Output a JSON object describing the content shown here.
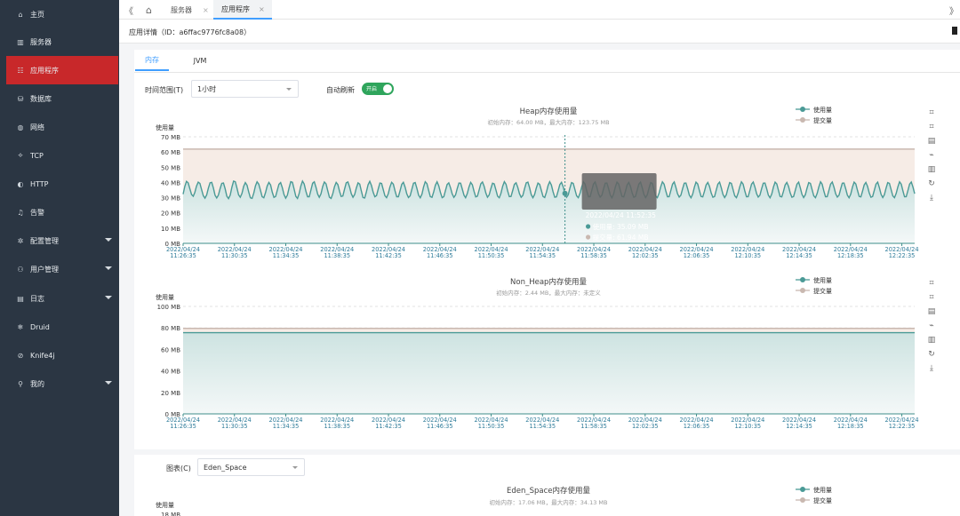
{
  "sidebar": {
    "items": [
      {
        "label": "主页",
        "icon": "home-icon",
        "glyph": "⌂"
      },
      {
        "label": "服务器",
        "icon": "server-icon",
        "glyph": "▥"
      },
      {
        "label": "应用程序",
        "icon": "app-icon",
        "glyph": "☷"
      },
      {
        "label": "数据库",
        "icon": "database-icon",
        "glyph": "⛁"
      },
      {
        "label": "网络",
        "icon": "network-icon",
        "glyph": "◍"
      },
      {
        "label": "TCP",
        "icon": "tcp-icon",
        "glyph": "⟡"
      },
      {
        "label": "HTTP",
        "icon": "http-icon",
        "glyph": "◐"
      },
      {
        "label": "告警",
        "icon": "bell-icon",
        "glyph": "♫"
      },
      {
        "label": "配置管理",
        "icon": "config-icon",
        "glyph": "✲"
      },
      {
        "label": "用户管理",
        "icon": "user-manage-icon",
        "glyph": "⚇"
      },
      {
        "label": "日志",
        "icon": "log-icon",
        "glyph": "▤"
      },
      {
        "label": "Druid",
        "icon": "druid-icon",
        "glyph": "❄"
      },
      {
        "label": "Knife4j",
        "icon": "knife-icon",
        "glyph": "⊘"
      },
      {
        "label": "我的",
        "icon": "user-icon",
        "glyph": "⚲"
      }
    ]
  },
  "topbar": {
    "collapse_glyph": "《",
    "home_glyph": "⌂",
    "tabs": [
      {
        "label": "服务器",
        "close": "×"
      },
      {
        "label": "应用程序",
        "close": "×"
      }
    ],
    "right_glyph": "》"
  },
  "breadcrumb": {
    "text": "应用详情（ID：a6ffac9776fc8a08）"
  },
  "subtabs": [
    "内存",
    "JVM"
  ],
  "controls": {
    "time_label": "时间范围(T)",
    "time_value": "1小时",
    "auto_label": "自动刷新",
    "toggle_text": "开启",
    "chart_select_label": "图表(C)",
    "chart_select_value": "Eden_Space"
  },
  "toolbox": [
    "⌗",
    "⌗",
    "▤",
    "⌁",
    "▥",
    "↻",
    "⤓"
  ],
  "colors": {
    "used": "#4a9a96",
    "committed": "#c9b8b0",
    "active": "#c8282a",
    "toggle": "#2fa55c"
  },
  "xticks": [
    "2022/04/24\n11:26:35",
    "2022/04/24\n11:30:35",
    "2022/04/24\n11:34:35",
    "2022/04/24\n11:38:35",
    "2022/04/24\n11:42:35",
    "2022/04/24\n11:46:35",
    "2022/04/24\n11:50:35",
    "2022/04/24\n11:54:35",
    "2022/04/24\n11:58:35",
    "2022/04/24\n12:02:35",
    "2022/04/24\n12:06:35",
    "2022/04/24\n12:10:35",
    "2022/04/24\n12:14:35",
    "2022/04/24\n12:18:35",
    "2022/04/24\n12:22:35"
  ],
  "chart_data": [
    {
      "type": "area",
      "title": "Heap内存使用量",
      "subtitle": "初始内存：64.00 MB，最大内存：123.75 MB",
      "ylabel": "使用量",
      "ylim": [
        0,
        70
      ],
      "yticks": [
        "0 MB",
        "10 MB",
        "20 MB",
        "30 MB",
        "40 MB",
        "50 MB",
        "60 MB",
        "70 MB"
      ],
      "legend": [
        "使用量",
        "提交量"
      ],
      "series": [
        {
          "name": "使用量",
          "values": [
            32.3,
            37.4,
            40.7,
            39.7,
            35.8,
            32.1,
            30.9,
            33.5,
            37.6,
            40.2,
            39.4,
            35.3,
            31.3,
            29.7,
            31.8,
            36.3,
            39.8,
            40.1,
            36.3,
            31.7,
            29.8,
            31.7,
            35.9,
            39.4,
            39.6,
            35.8,
            31.0,
            29.4,
            31.7,
            36.9,
            40.9,
            40.5,
            36.5,
            31.9,
            30.3,
            32.8,
            37.4,
            39.9,
            38.2,
            33.7,
            29.9,
            29.5,
            33.0,
            37.8,
            40.4,
            38.9,
            34.9,
            30.7,
            29.9,
            33.3,
            37.7,
            40.0,
            38.4,
            33.6,
            30.2,
            30.8,
            34.7,
            38.8,
            39.9,
            36.6,
            32.1,
            29.7,
            31.6,
            36.4,
            40.5,
            40.1,
            35.6,
            30.9,
            29.5,
            32.6,
            37.5,
            40.9,
            39.0,
            34.3,
            30.6,
            30.6,
            35.0,
            39.5,
            40.4,
            36.8,
            32.3,
            30.2,
            32.5,
            37.3,
            40.3,
            39.1,
            34.6,
            30.3,
            29.5,
            32.6,
            37.2,
            40.0,
            38.6,
            34.2,
            30.8,
            31.1,
            35.5,
            39.7,
            40.3,
            37.0,
            32.6,
            30.3,
            32.1,
            36.4,
            39.7,
            38.9,
            34.4,
            30.1,
            29.8,
            33.9,
            38.5,
            40.7,
            38.0,
            33.6,
            30.6,
            31.4,
            35.7,
            39.6,
            39.3,
            35.4,
            31.3,
            30.0,
            32.6,
            37.1,
            40.1,
            38.9,
            34.5,
            30.6,
            30.6,
            34.6,
            38.8,
            40.1,
            37.0,
            32.6,
            30.1,
            31.2,
            35.4,
            39.5,
            39.9,
            36.1,
            31.7,
            29.9,
            32.3,
            37.0,
            40.5,
            39.2,
            34.8,
            30.7,
            30.2,
            33.8,
            38.2,
            40.4,
            37.8,
            33.4,
            30.0,
            30.7,
            34.6,
            38.6,
            39.7,
            36.6,
            32.5,
            30.2,
            31.8,
            36.0,
            39.6,
            39.5,
            35.6,
            31.6,
            30.0,
            32.7,
            37.0,
            40.0,
            38.5,
            34.2,
            30.5,
            31.0,
            35.0,
            39.1,
            40.3,
            37.4,
            33.0,
            30.3,
            31.8,
            35.9,
            39.5,
            39.1,
            35.1,
            31.0,
            29.9,
            32.9,
            37.5,
            40.5,
            38.8,
            34.4,
            30.7,
            30.8,
            34.7,
            38.8,
            39.8,
            36.8,
            32.6,
            30.3,
            31.5,
            35.8,
            39.7,
            40.2,
            36.7,
            32.1,
            30.0,
            32.0,
            36.3,
            39.6,
            38.8,
            34.8,
            30.8,
            30.1,
            33.5,
            38.0,
            40.5,
            38.3,
            33.9,
            30.3,
            30.5,
            34.5,
            38.6,
            40.1,
            37.1,
            32.8,
            30.3,
            31.9,
            36.2,
            39.9,
            39.4,
            35.3,
            31.2,
            30.0,
            32.8,
            37.1,
            40.4,
            38.9,
            34.5,
            30.6,
            30.7,
            34.7,
            38.9,
            40.3,
            36.9,
            32.6,
            30.4,
            31.6,
            35.8,
            39.5,
            39.6,
            35.9,
            31.7,
            29.9,
            32.4,
            36.9,
            40.2,
            39.0,
            34.7,
            30.8,
            30.5,
            34.2,
            38.4,
            40.0,
            37.4,
            33.1,
            30.3,
            30.8,
            34.8,
            38.9,
            40.2,
            36.6,
            32.2,
            30.1,
            31.9,
            36.2,
            39.9,
            39.4,
            35.3,
            31.2,
            30.0,
            32.8,
            37.1,
            40.4,
            38.9,
            34.5,
            30.6,
            30.7,
            34.7,
            38.9,
            40.3,
            36.9,
            32.6,
            30.4,
            31.6,
            35.8,
            39.5,
            39.6,
            35.9,
            31.7,
            29.9,
            32.4,
            36.9,
            40.2,
            39.0,
            34.7,
            30.8,
            30.5,
            34.2,
            38.4,
            40.0,
            37.4,
            33.1,
            30.3,
            30.8,
            34.8,
            38.9,
            40.2,
            36.6,
            32.2,
            30.1,
            31.9,
            36.2,
            39.9,
            39.4,
            35.3,
            31.2,
            30.0,
            32.8,
            37.1,
            40.4,
            38.9,
            34.5,
            30.6,
            30.7,
            34.7,
            38.9,
            40.3,
            36.9,
            32.6,
            30.4,
            31.6,
            35.8,
            39.5,
            39.6,
            35.9,
            31.7,
            29.9,
            32.4,
            36.9,
            40.2,
            39.0,
            34.7,
            30.8,
            30.5,
            34.2,
            38.4,
            40.0,
            37.4,
            33.1,
            30.3,
            30.8,
            34.8,
            38.9,
            40.2,
            36.6,
            32.2,
            30.1,
            31.9,
            36.2,
            39.9,
            39.4,
            35.3,
            31.2,
            30.0,
            32.8,
            37.1,
            40.4,
            38.9,
            34.5,
            30.6,
            30.7,
            34.7,
            38.9,
            40.3,
            36.9,
            32.6,
            30.4,
            31.6,
            35.8,
            39.5,
            39.6,
            35.9,
            31.7,
            29.9,
            32.4,
            36.9,
            40.2,
            39.0,
            34.7,
            30.8,
            30.5,
            34.2,
            38.4,
            40.0,
            37.4,
            33.1,
            30.3,
            30.8,
            34.8,
            38.9,
            40.2,
            36.6,
            32.2,
            30.1,
            31.9,
            36.2,
            39.9,
            39.4,
            35.3,
            31.2,
            30.0,
            32.8,
            37.1,
            40.4,
            38.9,
            34.5,
            30.6,
            30.7,
            34.7,
            38.9,
            40.3,
            36.9,
            32.6
          ]
        },
        {
          "name": "提交量",
          "values": [
            61.94
          ]
        }
      ],
      "tooltip": {
        "time": "2022/04/24 11:52:35",
        "used": "使用量: 35.09 MB",
        "committed": "提交量: 61.94 MB",
        "x_index": 0.55
      }
    },
    {
      "type": "area",
      "title": "Non_Heap内存使用量",
      "subtitle": "初始内存：2.44 MB，最大内存：未定义",
      "ylabel": "使用量",
      "ylim": [
        0,
        100
      ],
      "yticks": [
        "0 MB",
        "20 MB",
        "40 MB",
        "60 MB",
        "80 MB",
        "100 MB"
      ],
      "legend": [
        "使用量",
        "提交量"
      ],
      "series": [
        {
          "name": "使用量",
          "values": [
            75.5
          ]
        },
        {
          "name": "提交量",
          "values": [
            79.5
          ]
        }
      ]
    },
    {
      "type": "area",
      "title": "Eden_Space内存使用量",
      "subtitle": "初始内存：17.06 MB，最大内存：34.13 MB",
      "ylabel": "使用量",
      "yticks": [
        "18 MB"
      ],
      "legend": [
        "使用量",
        "提交量"
      ]
    }
  ]
}
